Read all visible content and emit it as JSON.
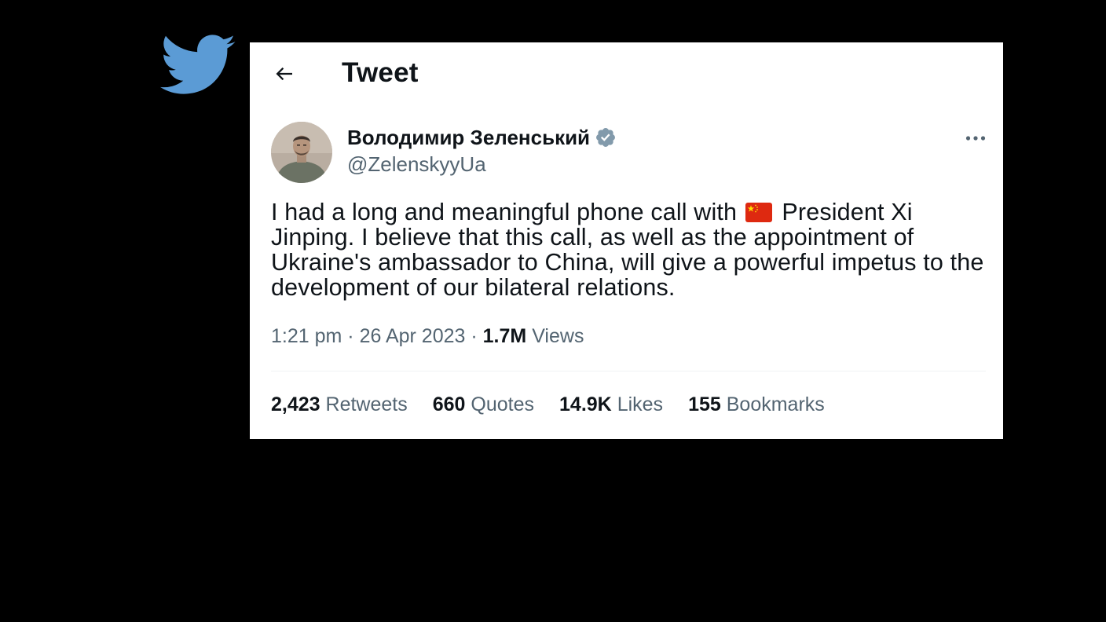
{
  "header": {
    "title": "Tweet"
  },
  "author": {
    "name": "Володимир Зеленський",
    "handle": "@ZelenskyyUa",
    "verified": true
  },
  "tweet": {
    "text_before_flag": "I had a long and meaningful phone call with ",
    "flag": "china-flag-emoji",
    "text_after_flag": " President Xi Jinping. I believe that this call, as well as the appointment of Ukraine's ambassador to China, will give a powerful impetus to the development of our bilateral relations."
  },
  "meta": {
    "time": "1:21 pm",
    "separator": "·",
    "date": "26 Apr 2023",
    "views_count": "1.7M",
    "views_label": "Views"
  },
  "stats": {
    "retweets_count": "2,423",
    "retweets_label": "Retweets",
    "quotes_count": "660",
    "quotes_label": "Quotes",
    "likes_count": "14.9K",
    "likes_label": "Likes",
    "bookmarks_count": "155",
    "bookmarks_label": "Bookmarks"
  },
  "colors": {
    "background": "#000000",
    "card": "#ffffff",
    "twitter_blue": "#5b9bd5",
    "text_primary": "#0f1419",
    "text_secondary": "#536471",
    "verified_badge": "#829aab"
  }
}
